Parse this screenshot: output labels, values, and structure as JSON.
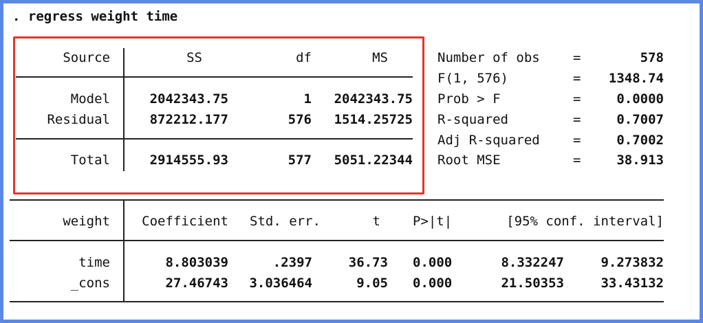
{
  "command": ". regress weight time",
  "anova": {
    "headers": {
      "source": "Source",
      "ss": "SS",
      "df": "df",
      "ms": "MS"
    },
    "rows": [
      {
        "source": "Model",
        "ss": "2042343.75",
        "df": "1",
        "ms": "2042343.75"
      },
      {
        "source": "Residual",
        "ss": "872212.177",
        "df": "576",
        "ms": "1514.25725"
      }
    ],
    "total": {
      "source": "Total",
      "ss": "2914555.93",
      "df": "577",
      "ms": "5051.22344"
    }
  },
  "stats": [
    {
      "label": "Number of obs",
      "eq": "=",
      "value": "578"
    },
    {
      "label": "F(1, 576)",
      "eq": "=",
      "value": "1348.74"
    },
    {
      "label": "Prob > F",
      "eq": "=",
      "value": "0.0000"
    },
    {
      "label": "R-squared",
      "eq": "=",
      "value": "0.7007"
    },
    {
      "label": "Adj R-squared",
      "eq": "=",
      "value": "0.7002"
    },
    {
      "label": "Root MSE",
      "eq": "=",
      "value": "38.913"
    }
  ],
  "coef_table": {
    "headers": {
      "var": "weight",
      "coef": "Coefficient",
      "se": "Std. err.",
      "t": "t",
      "p": "P>|t|",
      "ci": "[95% conf. interval]"
    },
    "rows": [
      {
        "var": "time",
        "coef": "8.803039",
        "se": ".2397",
        "t": "36.73",
        "p": "0.000",
        "ci_low": "8.332247",
        "ci_high": "9.273832"
      },
      {
        "var": "_cons",
        "coef": "27.46743",
        "se": "3.036464",
        "t": "9.05",
        "p": "0.000",
        "ci_low": "21.50353",
        "ci_high": "33.43132"
      }
    ]
  },
  "colors": {
    "frame": "#5b87e6",
    "highlight": "#e0362c",
    "text": "#111111"
  }
}
